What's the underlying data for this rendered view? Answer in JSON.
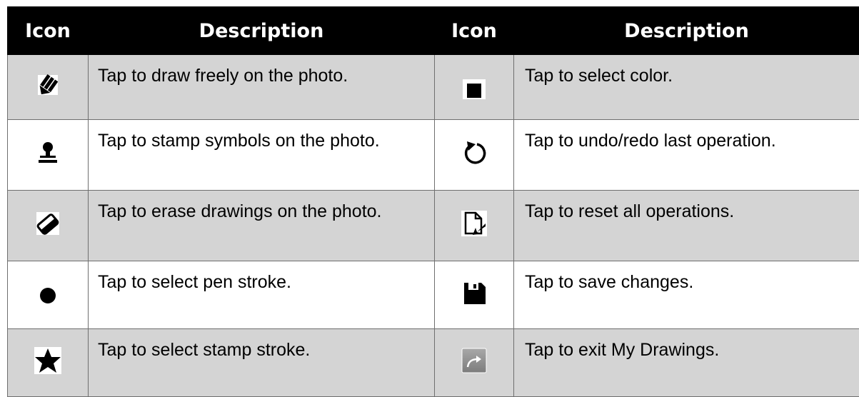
{
  "header": {
    "icon_col_left": "Icon",
    "description_col_left": "Description",
    "icon_col_right": "Icon",
    "description_col_right": "Description"
  },
  "rows": [
    {
      "left": {
        "icon": "draw-pen-icon",
        "description": "Tap to draw freely on the photo."
      },
      "right": {
        "icon": "color-swatch-icon",
        "description": "Tap to select color."
      }
    },
    {
      "left": {
        "icon": "stamp-icon",
        "description": "Tap to stamp symbols on the photo."
      },
      "right": {
        "icon": "undo-redo-icon",
        "description": "Tap to undo/redo last operation."
      }
    },
    {
      "left": {
        "icon": "eraser-icon",
        "description": "Tap to erase drawings on the photo."
      },
      "right": {
        "icon": "reset-icon",
        "description": "Tap to reset all operations."
      }
    },
    {
      "left": {
        "icon": "pen-stroke-icon",
        "description": "Tap to select pen stroke."
      },
      "right": {
        "icon": "save-icon",
        "description": "Tap to save changes."
      }
    },
    {
      "left": {
        "icon": "stamp-stroke-star-icon",
        "description": "Tap to select stamp stroke."
      },
      "right": {
        "icon": "exit-arrow-icon",
        "description": "Tap to exit My Drawings."
      }
    }
  ],
  "colors": {
    "header_bg": "#000000",
    "header_text": "#ffffff",
    "row_grey": "#d4d4d4",
    "row_white": "#ffffff",
    "border": "#6f6f6f"
  }
}
